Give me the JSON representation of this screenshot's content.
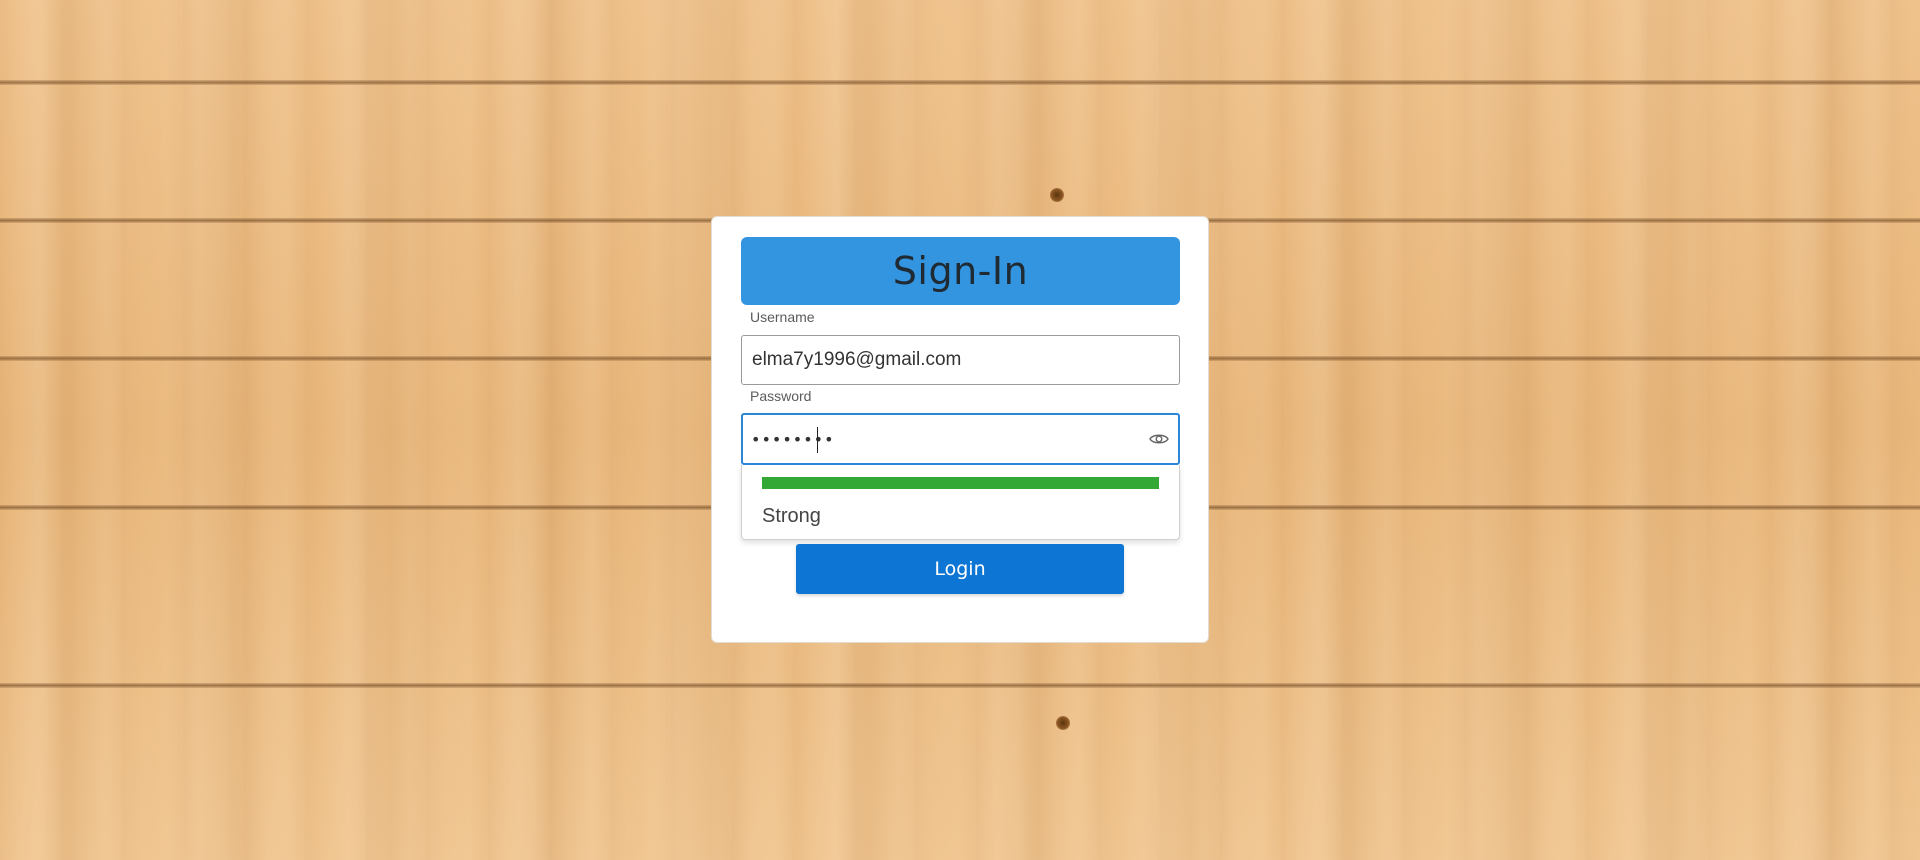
{
  "login": {
    "title": "Sign-In",
    "username_label": "Username",
    "username_value": "elma7y1996@gmail.com",
    "password_label": "Password",
    "password_value": "••••••••",
    "password_visibility_icon": "eye-icon",
    "strength_label": "Strong",
    "strength_fraction": 1.0,
    "login_label": "Login"
  },
  "colors": {
    "header_bg": "#3394e0",
    "focus_border": "#2d86d8",
    "strength_strong": "#33a834",
    "button_bg": "#0d76d4"
  }
}
